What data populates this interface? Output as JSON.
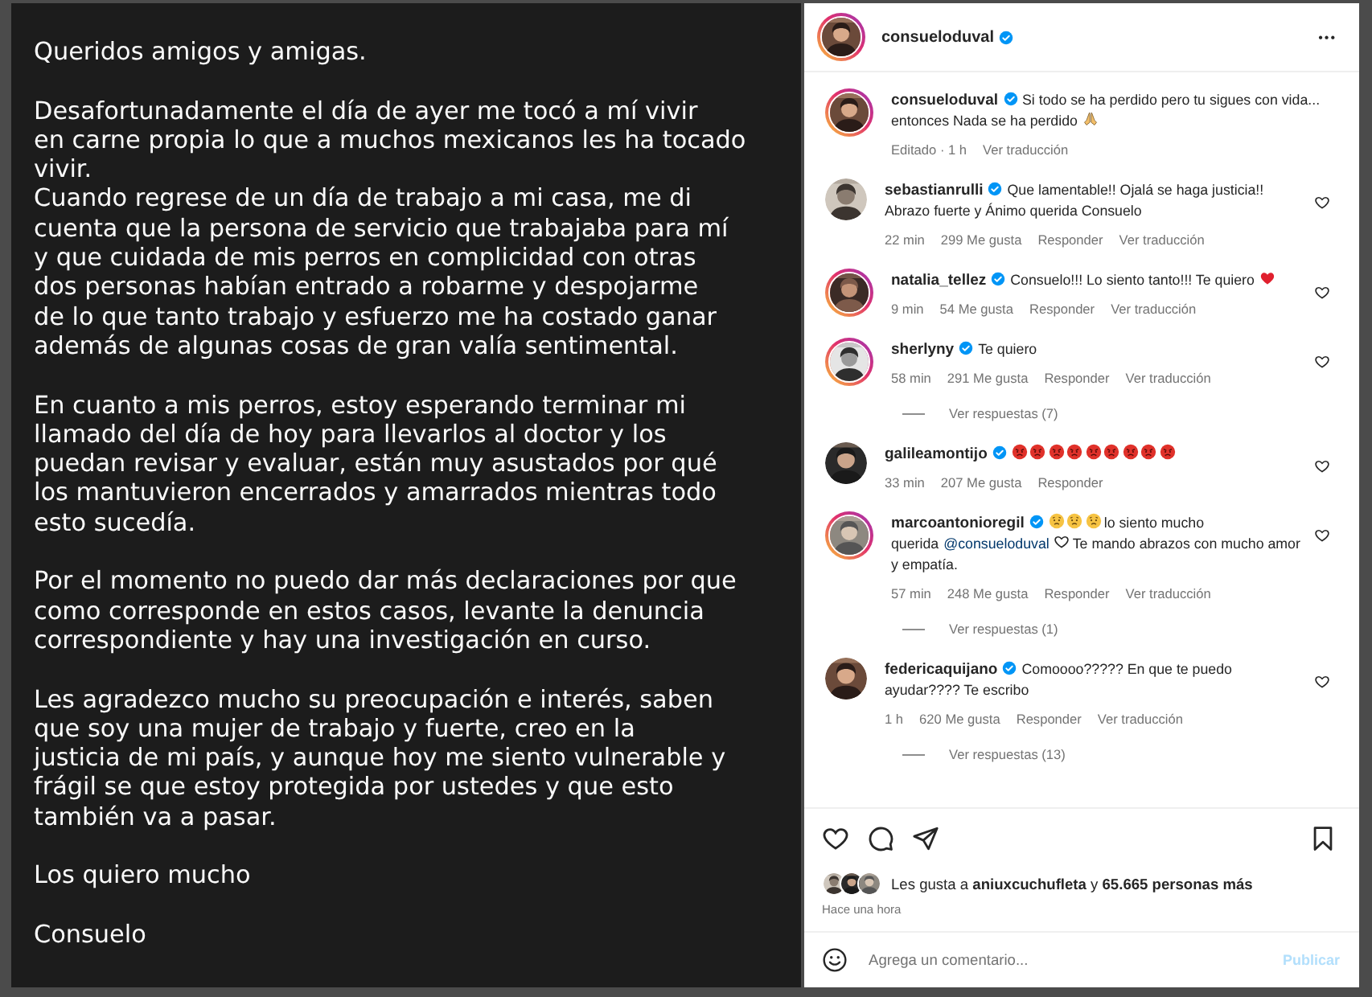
{
  "post_image": {
    "paragraphs": [
      [
        "Queridos amigos y amigas."
      ],
      [
        "Desafortunadamente el día de ayer me tocó a mí vivir",
        "en carne propia lo que a muchos mexicanos les ha tocado",
        "vivir.",
        "Cuando regrese de un día de trabajo a mi casa, me di",
        "cuenta que la persona de servicio que trabajaba para mí",
        "y que cuidada de mis perros en complicidad con otras",
        "dos personas habían entrado a robarme y despojarme",
        "de lo que tanto trabajo y esfuerzo me ha costado ganar",
        "además de algunas cosas de gran valía sentimental."
      ],
      [
        "En cuanto a mis perros, estoy esperando terminar mi",
        "llamado del día de hoy para llevarlos al doctor y los",
        "puedan revisar y evaluar, están muy asustados por qué",
        "los mantuvieron encerrados y amarrados mientras todo",
        "esto sucedía."
      ],
      [
        "Por el momento no puedo dar más declaraciones por que",
        "como corresponde en estos casos, levante la denuncia",
        "correspondiente y hay una investigación en curso."
      ],
      [
        "Les agradezco mucho su preocupación e interés, saben",
        "que soy una mujer de trabajo y fuerte, creo en la",
        "justicia de mi país, y aunque hoy me siento vulnerable y",
        "frágil se que estoy protegida por ustedes y que esto",
        "también va a pasar."
      ],
      [
        "Los quiero mucho"
      ],
      [
        "Consuelo"
      ]
    ]
  },
  "header": {
    "username": "consueloduval",
    "verified": true,
    "story_ring": true,
    "menu": "•••"
  },
  "caption": {
    "username": "consueloduval",
    "verified": true,
    "story_ring": true,
    "parts": [
      {
        "kind": "text",
        "text": "Si todo se ha perdido pero tu sigues con vida... entonces Nada se ha perdido"
      },
      {
        "kind": "praying_hands"
      }
    ],
    "meta": [
      "Editado · 1 h",
      "Ver traducción"
    ]
  },
  "comments": [
    {
      "username": "sebastianrulli",
      "verified": true,
      "story_ring": false,
      "parts": [
        {
          "kind": "text",
          "text": "Que lamentable!! Ojalá se haga justicia!! Abrazo fuerte y Ánimo querida Consuelo"
        }
      ],
      "time": "22 min",
      "likes": "299 Me gusta",
      "reply": "Responder",
      "translate": "Ver traducción"
    },
    {
      "username": "natalia_tellez",
      "verified": true,
      "story_ring": true,
      "parts": [
        {
          "kind": "text",
          "text": "Consuelo!!! Lo siento tanto!!! Te quiero"
        },
        {
          "kind": "red_heart"
        }
      ],
      "time": "9 min",
      "likes": "54 Me gusta",
      "reply": "Responder",
      "translate": "Ver traducción"
    },
    {
      "username": "sherlyny",
      "verified": true,
      "story_ring": true,
      "parts": [
        {
          "kind": "text",
          "text": "Te quiero"
        }
      ],
      "time": "58 min",
      "likes": "291 Me gusta",
      "reply": "Responder",
      "translate": "Ver traducción",
      "replies": "Ver respuestas (7)"
    },
    {
      "username": "galileamontijo",
      "verified": true,
      "story_ring": false,
      "parts": [
        {
          "kind": "angry_face"
        },
        {
          "kind": "angry_face"
        },
        {
          "kind": "angry_face"
        },
        {
          "kind": "angry_face"
        },
        {
          "kind": "angry_face"
        },
        {
          "kind": "angry_face"
        },
        {
          "kind": "angry_face"
        },
        {
          "kind": "angry_face"
        },
        {
          "kind": "angry_face"
        }
      ],
      "time": "33 min",
      "likes": "207 Me gusta",
      "reply": "Responder"
    },
    {
      "username": "marcoantonioregil",
      "verified": true,
      "story_ring": true,
      "parts": [
        {
          "kind": "sad_face"
        },
        {
          "kind": "sad_face"
        },
        {
          "kind": "sad_face"
        },
        {
          "kind": "text",
          "text": "lo siento mucho querida"
        },
        {
          "kind": "mention",
          "text": "@consueloduval"
        },
        {
          "kind": "heart_outline"
        },
        {
          "kind": "text",
          "text": "Te mando abrazos con mucho amor y empatía."
        }
      ],
      "time": "57 min",
      "likes": "248 Me gusta",
      "reply": "Responder",
      "translate": "Ver traducción",
      "replies": "Ver respuestas (1)"
    },
    {
      "username": "federicaquijano",
      "verified": true,
      "story_ring": false,
      "parts": [
        {
          "kind": "text",
          "text": "Comoooo????? En que te puedo ayudar???? Te escribo"
        }
      ],
      "time": "1 h",
      "likes": "620 Me gusta",
      "reply": "Responder",
      "translate": "Ver traducción",
      "replies": "Ver respuestas (13)"
    }
  ],
  "likes": {
    "text": "Les gusta a **aniuxcuchufleta** y **65.665 personas más**",
    "when": "Hace una hora"
  },
  "comment_box": {
    "placeholder": "Agrega un comentario...",
    "publish": "Publicar",
    "publish_disabled": true
  }
}
